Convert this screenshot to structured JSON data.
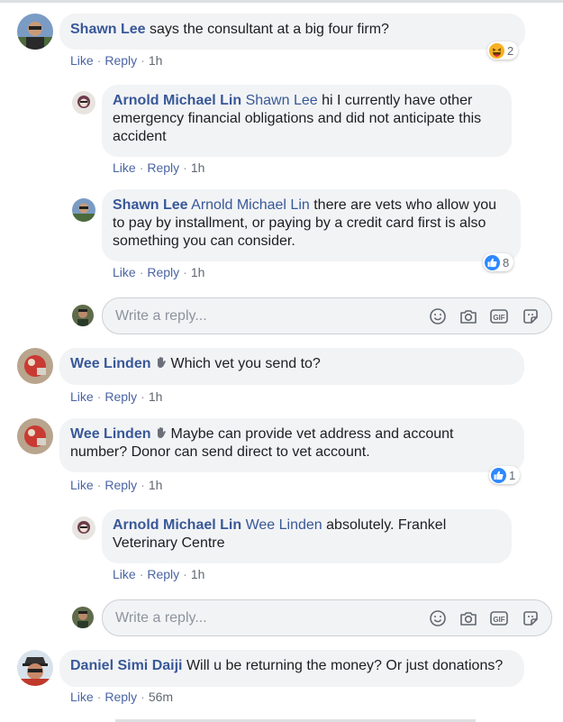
{
  "comments": [
    {
      "name": "Shawn Lee",
      "mention": "",
      "text": "says the consultant at a big four firm?",
      "time": "1h",
      "reaction_count": "2",
      "reaction": "haha"
    },
    {
      "name": "Arnold Michael Lin",
      "mention": "Shawn Lee",
      "text": "hi I currently have other emergency financial obligations and did not anticipate this accident",
      "time": "1h"
    },
    {
      "name": "Shawn Lee",
      "mention": "Arnold Michael Lin",
      "text": "there are vets who allow you to pay by installment, or paying by a credit card first is also something you can consider.",
      "time": "1h",
      "reaction_count": "8",
      "reaction": "like"
    },
    {
      "name": "Wee Linden",
      "mention": "",
      "text": "Which vet you send to?",
      "time": "1h"
    },
    {
      "name": "Wee Linden",
      "mention": "",
      "text": "Maybe can provide vet address and account number? Donor can send direct to vet account.",
      "time": "1h",
      "reaction_count": "1",
      "reaction": "like"
    },
    {
      "name": "Arnold Michael Lin",
      "mention": "Wee Linden",
      "text": "absolutely. Frankel Veterinary Centre",
      "time": "1h"
    },
    {
      "name": "Daniel Simi Daiji",
      "mention": "",
      "text": "Will u be returning the money? Or just donations?",
      "time": "56m"
    }
  ],
  "actions": {
    "like": "Like",
    "reply": "Reply",
    "sep": "·"
  },
  "reply_box": {
    "placeholder": "Write a reply..."
  },
  "colors": {
    "name": "#385898",
    "bubble": "#f2f3f5",
    "like": "#2d88ff",
    "haha": "#f7b125"
  },
  "icons": {
    "emoji": "emoji-icon",
    "camera": "camera-icon",
    "gif": "gif-icon",
    "sticker": "sticker-icon",
    "wave": "waving-hand-icon"
  }
}
